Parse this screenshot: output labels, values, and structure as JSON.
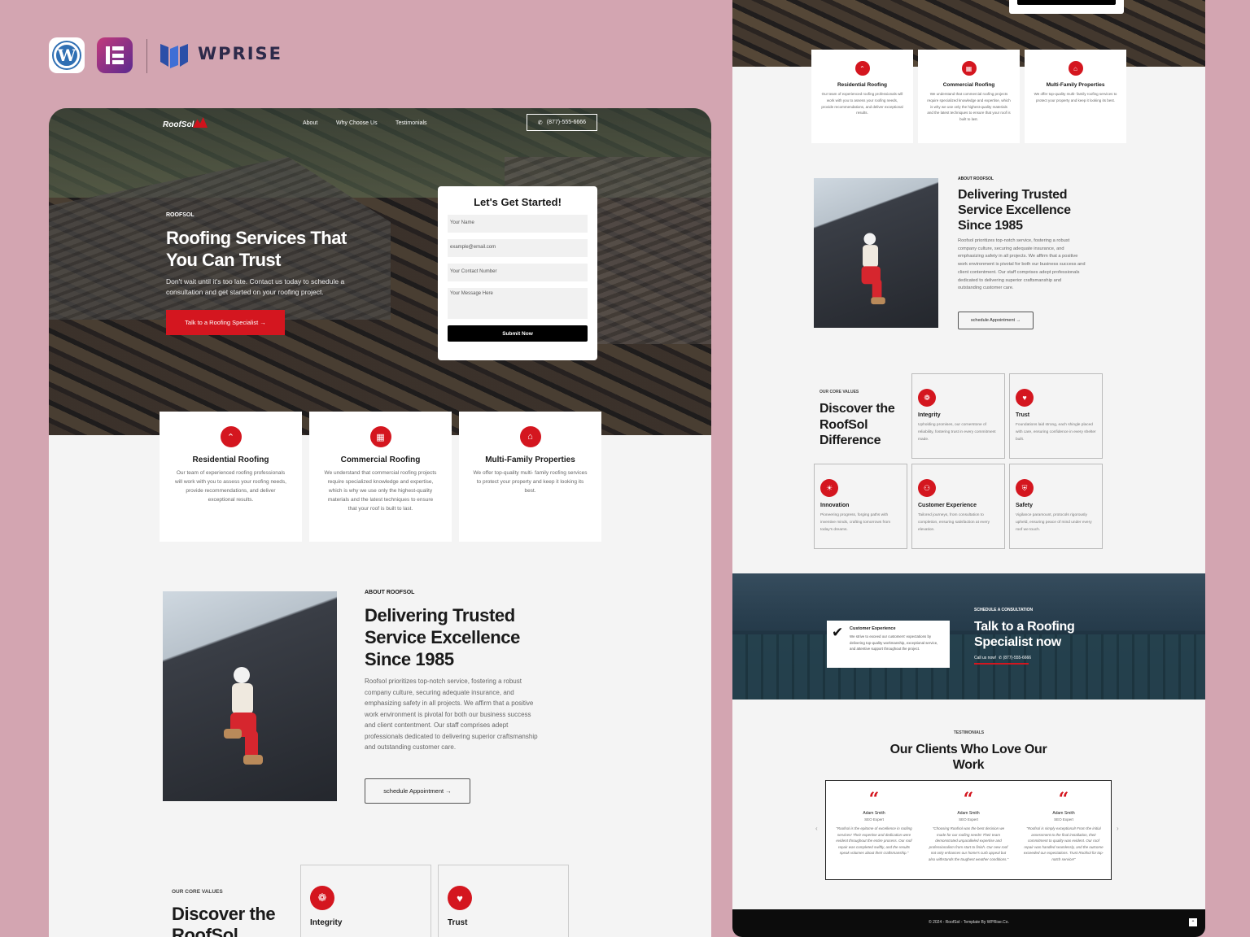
{
  "brand": {
    "wprise": "WPRISE",
    "wordpress_glyph": "W",
    "elementor_glyph": "E"
  },
  "site": {
    "brand_name": "RoofSol",
    "nav": [
      "About",
      "Why Choose Us",
      "Testimonials"
    ],
    "phone": "(877)-555-6666",
    "hero": {
      "eyebrow": "ROOFSOL",
      "title": "Roofing Services That You Can Trust",
      "subtitle": "Don't wait until it's too late. Contact us today to schedule a consultation and get started on your roofing project.",
      "cta": "Talk to a Roofing Specialist →"
    },
    "form": {
      "title": "Let's Get Started!",
      "name_placeholder": "Your Name",
      "email_placeholder": "example@email.com",
      "contact_placeholder": "Your Contact Number",
      "message_placeholder": "Your Message Here",
      "submit": "Submit Now"
    },
    "services": [
      {
        "title": "Residential Roofing",
        "icon": "roof-icon",
        "glyph": "⌃",
        "desc": "Our team of experienced roofing professionals will work with you to assess your roofing needs, provide recommendations, and deliver exceptional results."
      },
      {
        "title": "Commercial Roofing",
        "icon": "building-icon",
        "glyph": "▦",
        "desc": "We understand that commercial roofing projects require specialized knowledge and expertise, which is why we use only the highest-quality materials and the latest techniques to ensure that your roof is built to last."
      },
      {
        "title": "Multi-Family Properties",
        "icon": "houses-icon",
        "glyph": "⌂",
        "desc": "We offer top-quality multi- family roofing services to protect your property and keep it looking its best."
      }
    ],
    "about": {
      "eyebrow": "ABOUT ROOFSOL",
      "title": "Delivering Trusted Service Excellence Since 1985",
      "body": "Roofsol prioritizes top-notch service, fostering a robust company culture, securing adequate insurance, and emphasizing safety in all projects. We affirm that a positive work environment is pivotal for both our business success and client contentment. Our staff comprises adept professionals dedicated to delivering superior craftsmanship and outstanding customer care.",
      "button": "schedule Appointment →"
    },
    "core_values": {
      "eyebrow": "OUR CORE VALUES",
      "title": "Discover the RoofSol Difference",
      "items": [
        {
          "name": "Integrity",
          "icon": "handshake-icon",
          "glyph": "❁",
          "desc": "Upholding promises, our cornerstone of reliability, fostering trust in every commitment made."
        },
        {
          "name": "Trust",
          "icon": "hands-heart-icon",
          "glyph": "♥",
          "desc": "Foundations laid strong, each shingle placed with care, ensuring confidence in every shelter built."
        },
        {
          "name": "Innovation",
          "icon": "lightbulb-icon",
          "glyph": "☀",
          "desc": "Pioneering progress, forging paths with inventive minds, crafting tomorrows from today's dreams."
        },
        {
          "name": "Customer Experience",
          "icon": "people-icon",
          "glyph": "⚇",
          "desc": "Tailored journeys, from consultation to completion, ensuring satisfaction at every elevation."
        },
        {
          "name": "Safety",
          "icon": "shield-icon",
          "glyph": "⛨",
          "desc": "Vigilance paramount, protocols rigorously upheld, ensuring peace of mind under every roof we touch."
        }
      ]
    },
    "cta": {
      "card_title": "Customer Experience",
      "card_desc": "We strive to exceed our customers' expectations by delivering top-quality workmanship, exceptional service, and attentive support throughout the project.",
      "eyebrow": "SCHEDULE A CONSULTATION",
      "title": "Talk to a Roofing Specialist now",
      "call_label": "Call us now!",
      "phone": "(877)-555-6666"
    },
    "testimonials": {
      "eyebrow": "TESTIMONIALS",
      "title": "Our Clients Who Love Our Work",
      "items": [
        {
          "name": "Adam Smith",
          "role": "SEO Expert",
          "text": "“Roofsol is the epitome of excellence in roofing services! Their expertise and dedication were evident throughout the entire process. Our roof repair was completed swiftly, and the results speak volumes about their craftsmanship.”"
        },
        {
          "name": "Adam Smith",
          "role": "SEO Expert",
          "text": "“Choosing Roofsol was the best decision we made for our roofing needs! Their team demonstrated unparalleled expertise and professionalism from start to finish. Our new roof not only enhances our home's curb appeal but also withstands the toughest weather conditions.”"
        },
        {
          "name": "Adam Smith",
          "role": "SEO Expert",
          "text": "“Roofsol is simply exceptional! From the initial assessment to the final installation, their commitment to quality was evident. Our roof repair was handled seamlessly, and the outcome exceeded our expectations. Trust Roofsol for top-notch service!”"
        }
      ]
    },
    "footer": "© 2024 - RoofSol - Template By WPRise.Co."
  },
  "colors": {
    "accent": "#d4161f",
    "background": "#d3a5b1",
    "dark": "#0c0c0c"
  }
}
